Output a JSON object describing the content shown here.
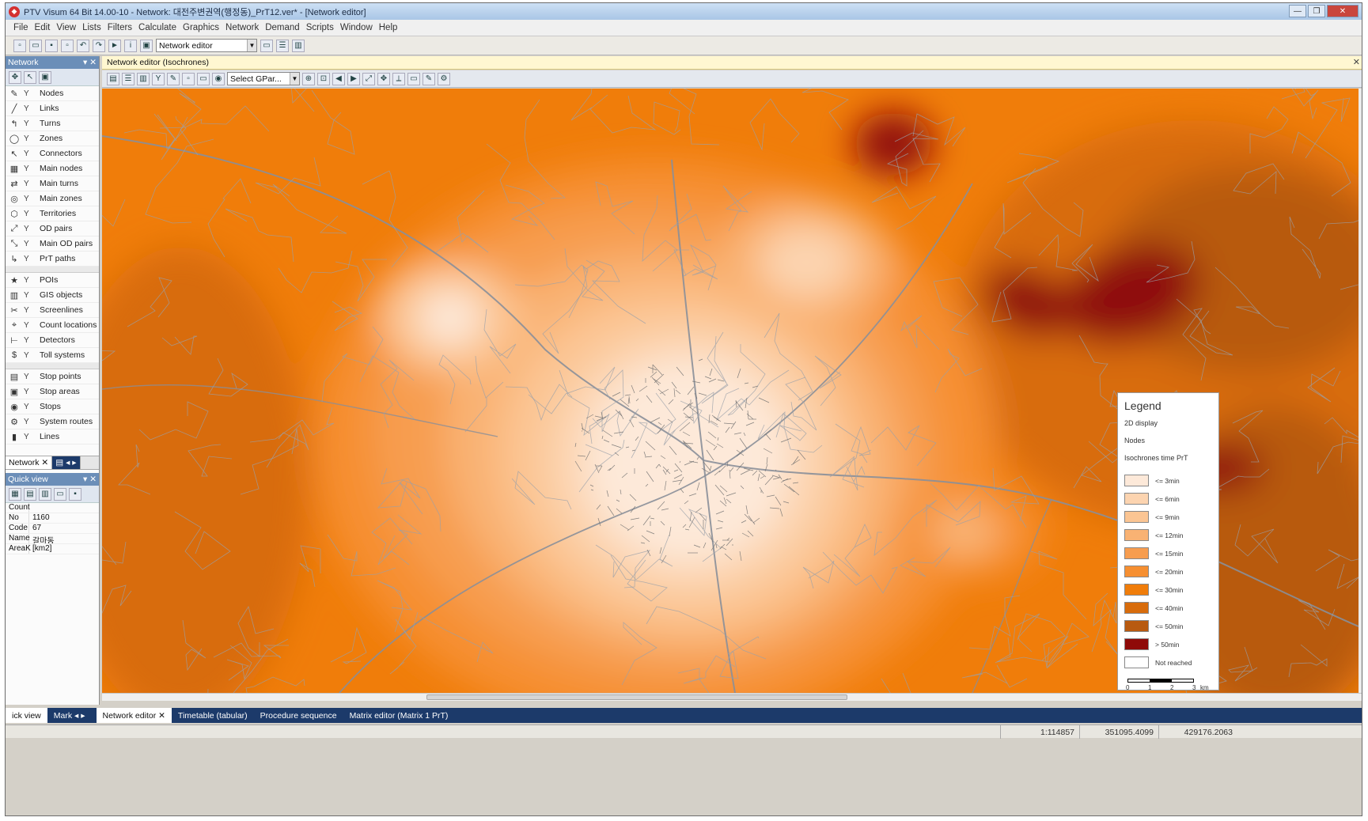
{
  "window": {
    "title": "PTV Visum 64 Bit 14.00-10 - Network: 대전주변권역(행정동)_PrT12.ver* - [Network editor]",
    "minimize": "—",
    "maximize": "❐",
    "close": "✕"
  },
  "menu": [
    "File",
    "Edit",
    "View",
    "Lists",
    "Filters",
    "Calculate",
    "Graphics",
    "Network",
    "Demand",
    "Scripts",
    "Window",
    "Help"
  ],
  "toolbar": {
    "mode_select": "Network editor"
  },
  "network_panel": {
    "title": "Network",
    "items_group1": [
      {
        "icon": "✎",
        "label": "Nodes"
      },
      {
        "icon": "╱",
        "label": "Links"
      },
      {
        "icon": "↰",
        "label": "Turns"
      },
      {
        "icon": "◯",
        "label": "Zones"
      },
      {
        "icon": "↖",
        "label": "Connectors"
      },
      {
        "icon": "▦",
        "label": "Main nodes"
      },
      {
        "icon": "⇄",
        "label": "Main turns"
      },
      {
        "icon": "◎",
        "label": "Main zones"
      },
      {
        "icon": "⬡",
        "label": "Territories"
      },
      {
        "icon": "⤢",
        "label": "OD pairs"
      },
      {
        "icon": "⤡",
        "label": "Main OD pairs"
      },
      {
        "icon": "↳",
        "label": "PrT paths"
      }
    ],
    "items_group2": [
      {
        "icon": "★",
        "label": "POIs"
      },
      {
        "icon": "▥",
        "label": "GIS objects"
      },
      {
        "icon": "✂",
        "label": "Screenlines"
      },
      {
        "icon": "⌖",
        "label": "Count locations"
      },
      {
        "icon": "⊢",
        "label": "Detectors"
      },
      {
        "icon": "$",
        "label": "Toll systems"
      }
    ],
    "items_group3": [
      {
        "icon": "▤",
        "label": "Stop points"
      },
      {
        "icon": "▣",
        "label": "Stop areas"
      },
      {
        "icon": "◉",
        "label": "Stops"
      },
      {
        "icon": "⚙",
        "label": "System routes"
      },
      {
        "icon": "▮",
        "label": "Lines"
      }
    ],
    "tab_active": "Network",
    "filter_glyph": "Y"
  },
  "quick_view": {
    "title": "Quick view",
    "rows": [
      {
        "k": "Count",
        "v": ""
      },
      {
        "k": "No",
        "v": "1160"
      },
      {
        "k": "Code",
        "v": "67"
      },
      {
        "k": "Name",
        "v": "갈마동"
      },
      {
        "k": "AreaK",
        "v": "[km2]"
      }
    ]
  },
  "doc": {
    "header": "Network editor (Isochrones)",
    "gpa_select": "Select GPar...",
    "tabs": [
      "Network editor",
      "Timetable (tabular)",
      "Procedure sequence",
      "Matrix editor (Matrix 1 PrT)"
    ],
    "left_tabs": [
      "ick view",
      "Mark"
    ]
  },
  "legend": {
    "title": "Legend",
    "sub1": "2D display",
    "sub2": "Nodes",
    "sub3": "Isochrones time PrT",
    "items": [
      {
        "label": "<= 3min",
        "color": "#fde9d9"
      },
      {
        "label": "<= 6min",
        "color": "#fcd4b0"
      },
      {
        "label": "<= 9min",
        "color": "#fbc593"
      },
      {
        "label": "<= 12min",
        "color": "#f9b273"
      },
      {
        "label": "<= 15min",
        "color": "#f79d4f"
      },
      {
        "label": "<= 20min",
        "color": "#f68f31"
      },
      {
        "label": "<= 30min",
        "color": "#f07d0a"
      },
      {
        "label": "<= 40min",
        "color": "#d86c0c"
      },
      {
        "label": "<= 50min",
        "color": "#b85a10"
      },
      {
        "label": "> 50min",
        "color": "#8f0a08"
      },
      {
        "label": "Not reached",
        "color": "#ffffff"
      }
    ],
    "scale": [
      "0",
      "1",
      "2",
      "3",
      "km"
    ]
  },
  "status": {
    "scale": "1:114857",
    "x": "351095.4099",
    "y": "429176.2063"
  }
}
